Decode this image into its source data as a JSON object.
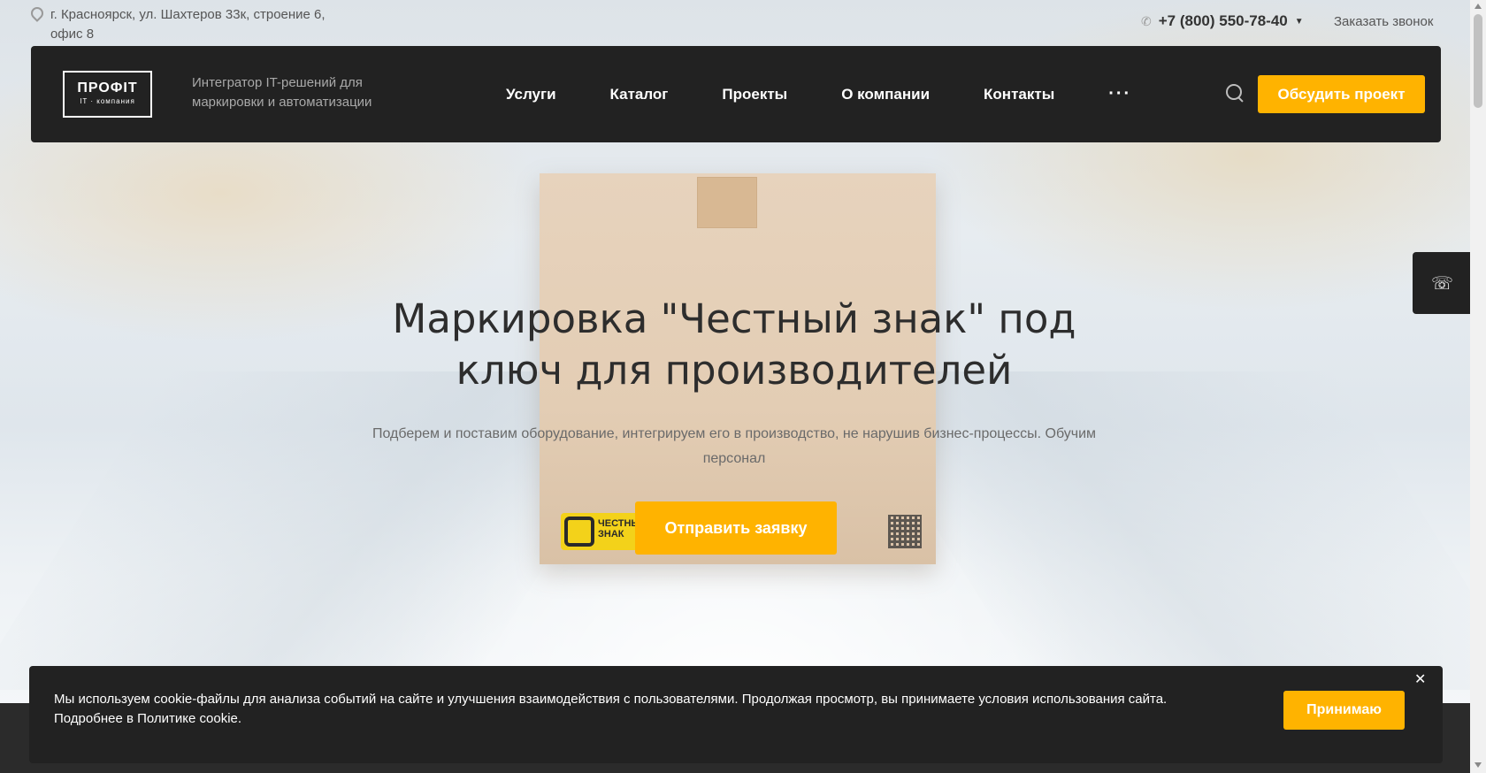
{
  "topbar": {
    "address": "г. Красноярск, ул. Шахтеров 33к, строение 6, офис 8",
    "phone": "+7 (800) 550-78-40",
    "callback": "Заказать звонок"
  },
  "header": {
    "logo_main": "ПРОФIТ",
    "logo_sub": "IT · компания",
    "tagline": "Интегратор IT-решений для маркировки и автоматизации",
    "nav": [
      "Услуги",
      "Каталог",
      "Проекты",
      "О компании",
      "Контакты"
    ],
    "more": "···",
    "cta": "Обсудить проект"
  },
  "hero": {
    "title": "Маркировка \"Честный знак\" под ключ для производителей",
    "subtitle": "Подберем и поставим оборудование, интегрируем его в производство, не нарушив бизнес-процессы. Обучим персонал",
    "cta": "Отправить заявку",
    "box_mark_text": "ЧЕСТНЫЙ ЗНАК"
  },
  "cookie": {
    "text": "Мы используем cookie-файлы для анализа событий на сайте и улучшения взаимодействия с пользователями. Продолжая просмотр, вы принимаете условия использования сайта.",
    "link": "Подробнее в Политике cookie.",
    "accept": "Принимаю",
    "close": "✕"
  },
  "colors": {
    "accent": "#ffb300",
    "dark": "#222222"
  },
  "icons": {
    "address": "map-pin-icon",
    "phone": "phone-icon",
    "search": "search-icon",
    "side_call": "phone-call-icon"
  }
}
